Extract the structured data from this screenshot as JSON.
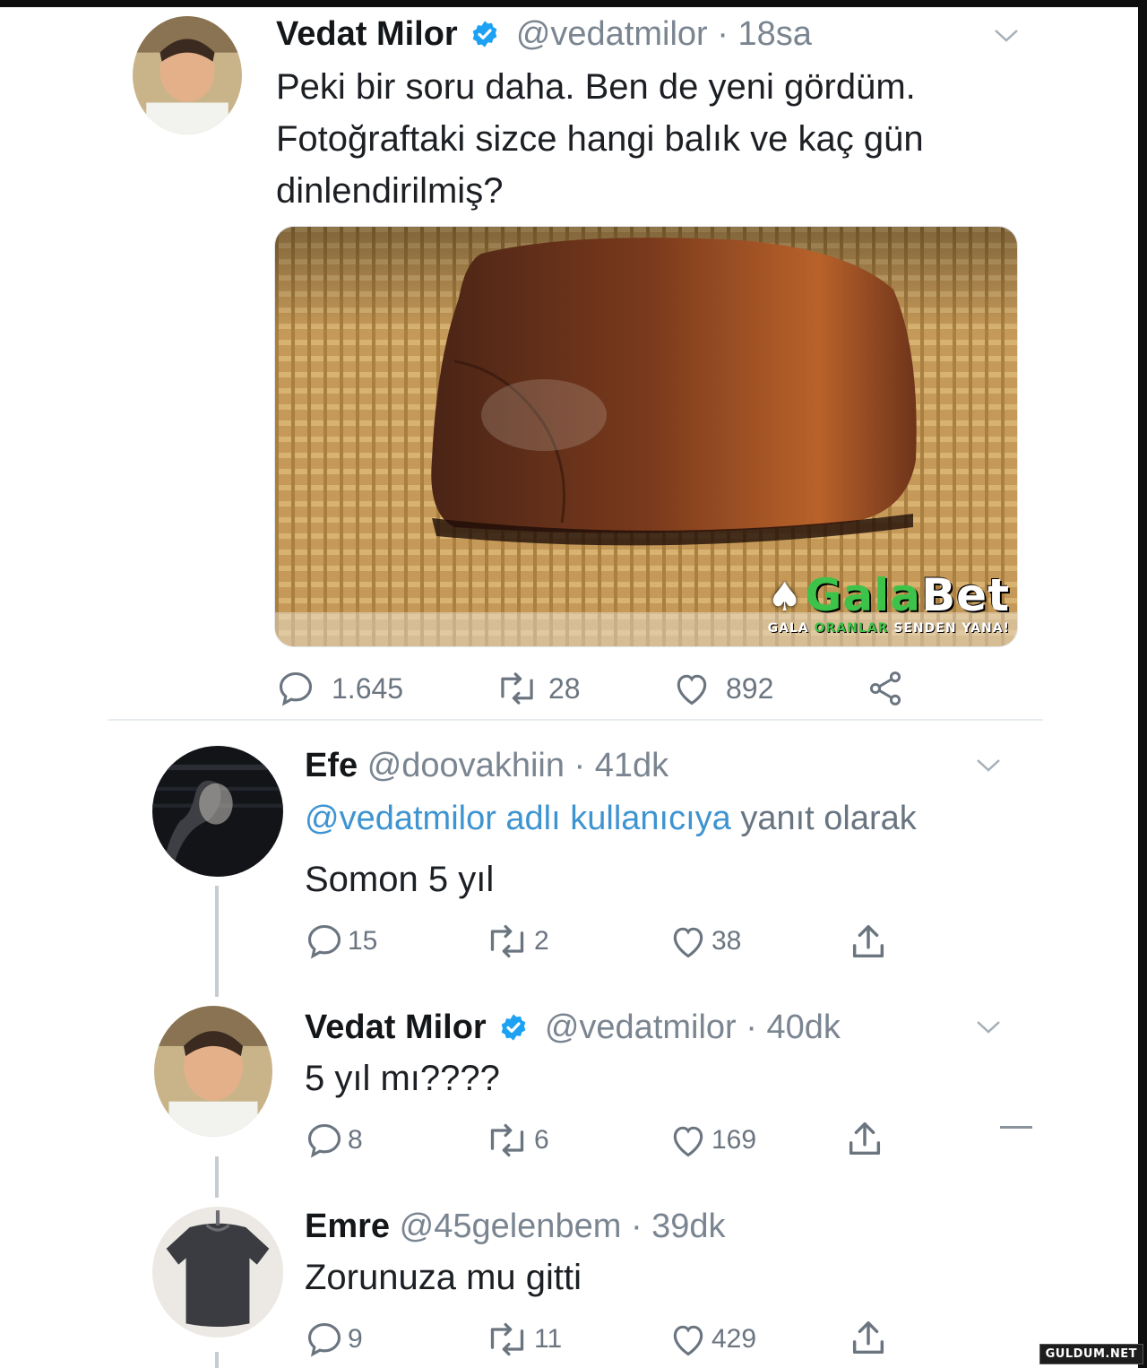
{
  "main_tweet": {
    "name": "Vedat Milor",
    "handle": "@vedatmilor",
    "separator": "·",
    "time": "18sa",
    "text_line1": "Peki bir soru daha. Ben de yeni gördüm.",
    "text_line2": "Fotoğraftaki sizce hangi balık ve kaç gün",
    "text_line3": "dinlendirilmiş?",
    "media_watermark": {
      "brand_part1": "Gala",
      "brand_part2": "Bet",
      "slogan_part1": "GALA ",
      "slogan_part2": "ORANLAR",
      "slogan_part3": " SENDEN YANA!"
    },
    "actions": {
      "replies": "1.645",
      "retweets": "28",
      "likes": "892"
    }
  },
  "reply1": {
    "name": "Efe",
    "handle": "@doovakhiin",
    "separator": "·",
    "time": "41dk",
    "reply_mention": "@vedatmilor adlı kullanıcıya",
    "reply_suffix": " yanıt olarak",
    "text": "Somon 5 yıl",
    "actions": {
      "replies": "15",
      "retweets": "2",
      "likes": "38"
    }
  },
  "reply2": {
    "name": "Vedat Milor",
    "handle": "@vedatmilor",
    "separator": "·",
    "time": "40dk",
    "text": "5 yıl mı????",
    "actions": {
      "replies": "8",
      "retweets": "6",
      "likes": "169"
    }
  },
  "reply3": {
    "name": "Emre",
    "handle": "@45gelenbem",
    "separator": "·",
    "time": "39dk",
    "text": "Zorunuza mu gitti",
    "actions": {
      "replies": "9",
      "retweets": "11",
      "likes": "429"
    }
  },
  "site_watermark": "GULDUM.NET",
  "colors": {
    "mention_blue": "#3e94d1",
    "verified_blue": "#1da1f2",
    "muted_gray": "#7a8591",
    "galabet_green": "#3ec34a"
  },
  "icons": [
    "verified-badge-icon",
    "chevron-down-icon",
    "reply-icon",
    "retweet-icon",
    "like-icon",
    "share-icon"
  ]
}
